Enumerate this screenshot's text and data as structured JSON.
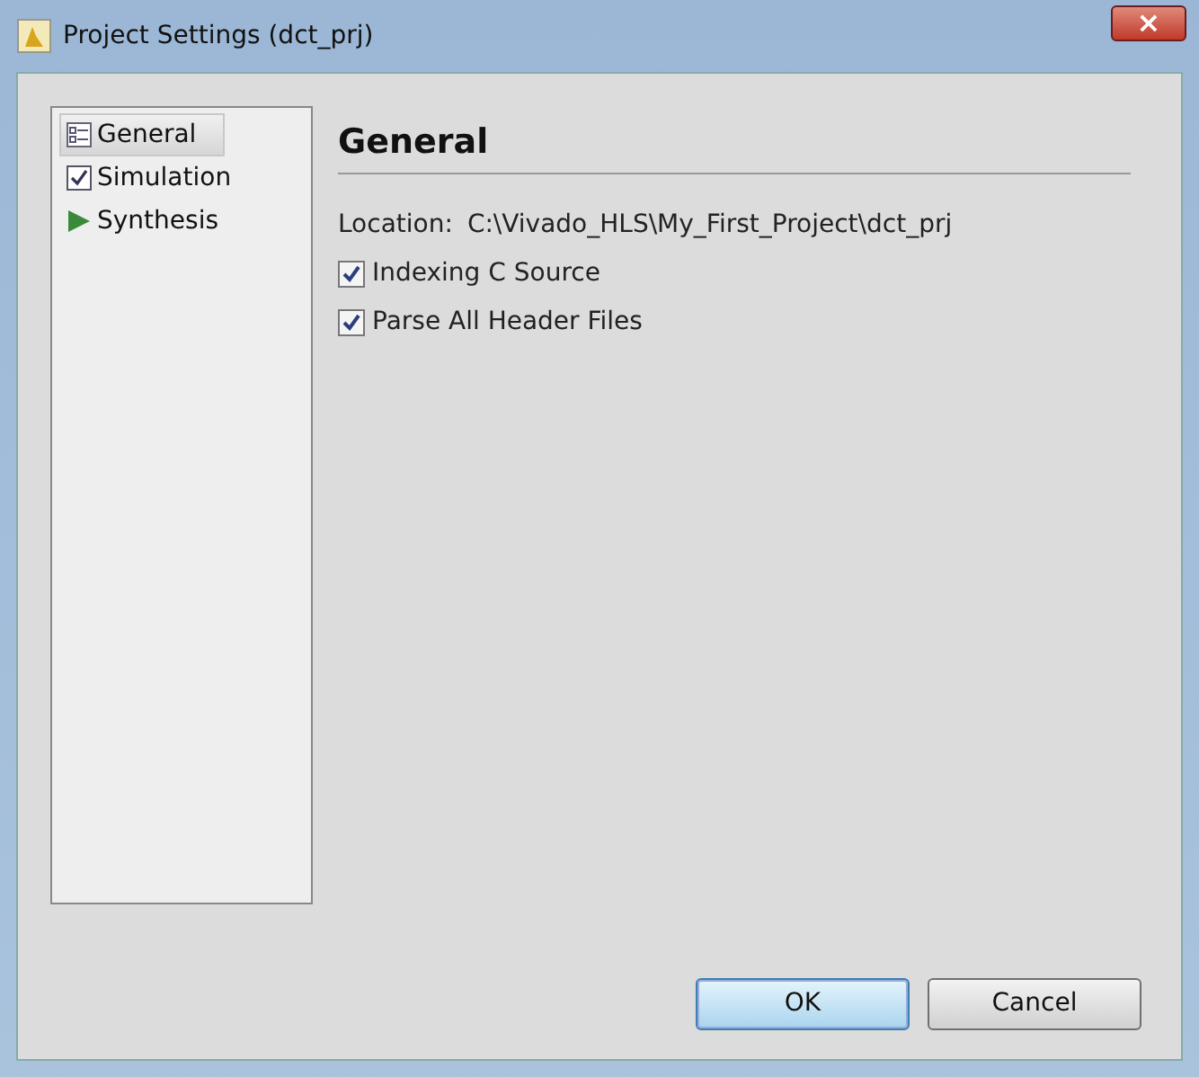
{
  "window": {
    "title": "Project Settings (dct_prj)",
    "close": "×"
  },
  "sidebar": {
    "items": [
      {
        "label": "General",
        "kind": "list",
        "selected": true
      },
      {
        "label": "Simulation",
        "kind": "check",
        "selected": false
      },
      {
        "label": "Synthesis",
        "kind": "play",
        "selected": false
      }
    ]
  },
  "panel": {
    "heading": "General",
    "location_label": "Location:",
    "location_value": "C:\\Vivado_HLS\\My_First_Project\\dct_prj",
    "options": [
      {
        "label": "Indexing C Source",
        "checked": true
      },
      {
        "label": "Parse All Header Files",
        "checked": true
      }
    ]
  },
  "buttons": [
    {
      "label": "OK",
      "default": true
    },
    {
      "label": "Cancel",
      "default": false
    }
  ]
}
